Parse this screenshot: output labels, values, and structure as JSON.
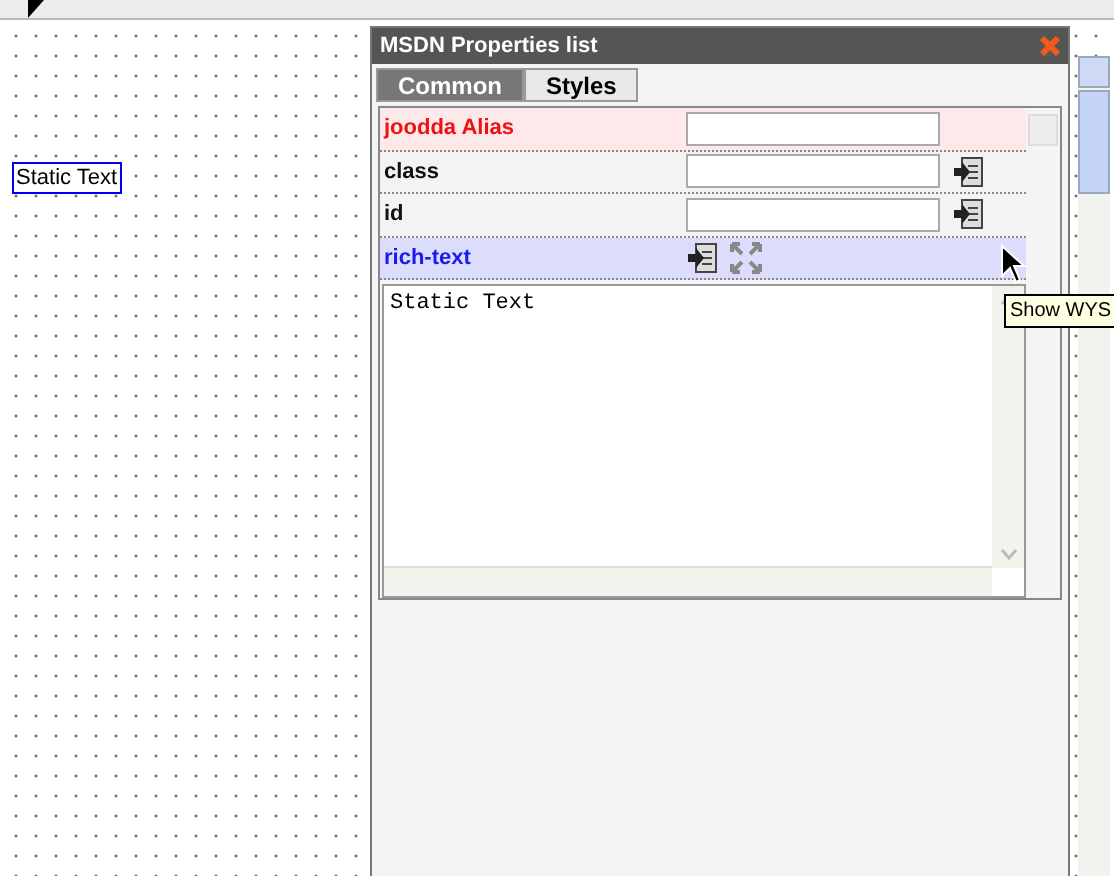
{
  "canvas": {
    "widget_text": "Static Text"
  },
  "panel": {
    "title": "MSDN Properties list",
    "tabs": [
      {
        "label": "Common",
        "selected": true
      },
      {
        "label": "Styles",
        "selected": false
      }
    ],
    "properties": [
      {
        "kind": "alias",
        "label": "joodda Alias"
      },
      {
        "kind": "field",
        "label": "class"
      },
      {
        "kind": "field",
        "label": "id"
      },
      {
        "kind": "richtext",
        "label": "rich-text"
      }
    ],
    "editor": {
      "value": "Static Text"
    }
  },
  "tooltip": "Show WYS"
}
